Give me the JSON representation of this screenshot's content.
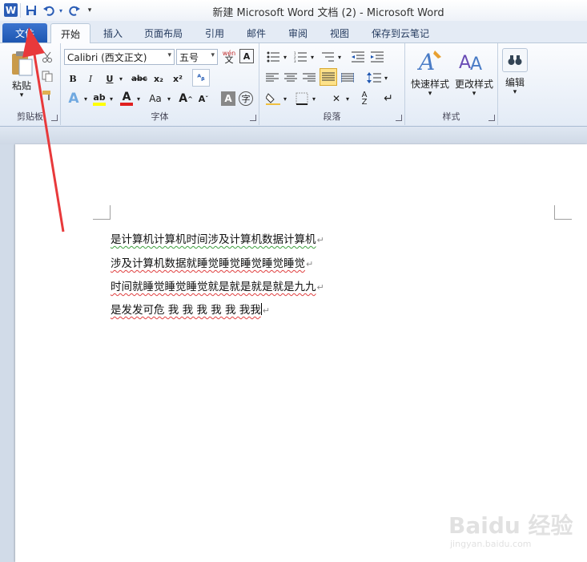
{
  "window": {
    "title": "新建 Microsoft Word 文档 (2) - Microsoft Word",
    "app_logo": "W"
  },
  "qat": {
    "save_icon": "save-icon",
    "undo_icon": "undo-icon",
    "redo_icon": "redo-icon",
    "customize_icon": "customize-qat-icon"
  },
  "tabs": [
    {
      "label": "文件"
    },
    {
      "label": "开始"
    },
    {
      "label": "插入"
    },
    {
      "label": "页面布局"
    },
    {
      "label": "引用"
    },
    {
      "label": "邮件"
    },
    {
      "label": "审阅"
    },
    {
      "label": "视图"
    },
    {
      "label": "保存到云笔记"
    }
  ],
  "ribbon": {
    "clipboard": {
      "label": "剪贴板",
      "paste_label": "粘贴"
    },
    "font": {
      "label": "字体",
      "font_name": "Calibri (西文正文)",
      "font_size": "五号",
      "bold": "B",
      "italic": "I",
      "underline": "U",
      "strike": "abc",
      "subscript": "x₂",
      "superscript": "x²",
      "grow": "A",
      "shrink": "A",
      "aa": "Aa",
      "wen": "wén",
      "font_color_letter": "A",
      "highlight_letter": "ab"
    },
    "paragraph": {
      "label": "段落"
    },
    "styles": {
      "label": "样式",
      "quick_styles": "快速样式",
      "change_styles": "更改样式"
    },
    "editing": {
      "label": "编辑"
    }
  },
  "document": {
    "paragraphs": [
      "是计算机计算机时间涉及计算机数据计算机",
      "涉及计算机数据就睡觉睡觉睡觉睡觉睡觉",
      "时间就睡觉睡觉睡觉就是就是就是就是九九",
      "是发发可危 我 我 我 我 我 我我"
    ],
    "paragraph_mark": "↵"
  },
  "watermark": {
    "logo": "Baidu 经验",
    "url": "jingyan.baidu.com"
  },
  "colors": {
    "accent": "#2a5cb5",
    "annotation_arrow": "#e8393b"
  }
}
